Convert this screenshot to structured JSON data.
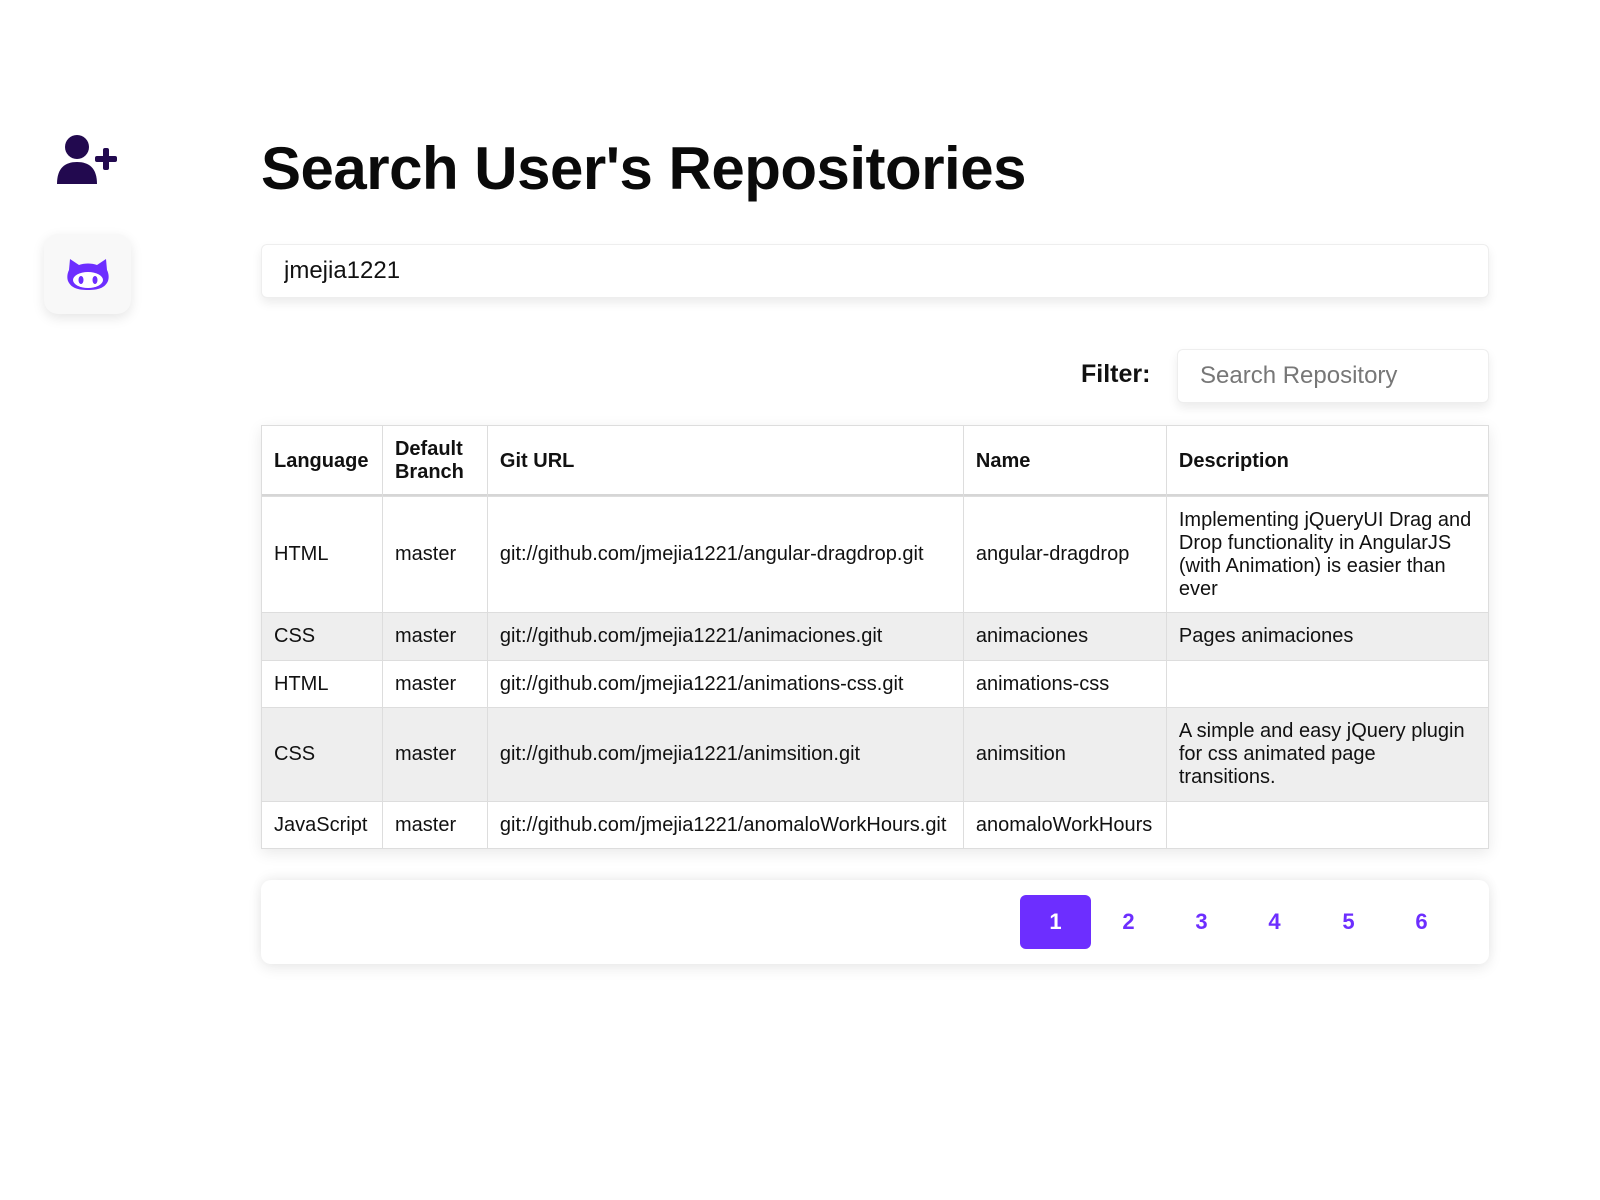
{
  "sidebar": {
    "add_user_icon": "user-plus-icon",
    "github_icon": "github-octocat-icon",
    "colors": {
      "add_user": "#22094f",
      "github": "#6d2eff",
      "github_bg": "#f8f8f8"
    }
  },
  "header": {
    "title": "Search User's Repositories"
  },
  "search": {
    "value": "jmejia1221"
  },
  "filter": {
    "label": "Filter:",
    "placeholder": "Search Repository",
    "value": ""
  },
  "table": {
    "columns": [
      "Language",
      "Default Branch",
      "Git URL",
      "Name",
      "Description"
    ],
    "rows": [
      {
        "language": "HTML",
        "branch": "master",
        "url": "git://github.com/jmejia1221/angular-dragdrop.git",
        "name": "angular-dragdrop",
        "description": "Implementing jQueryUI Drag and Drop functionality in AngularJS (with Animation) is easier than ever"
      },
      {
        "language": "CSS",
        "branch": "master",
        "url": "git://github.com/jmejia1221/animaciones.git",
        "name": "animaciones",
        "description": "Pages animaciones"
      },
      {
        "language": "HTML",
        "branch": "master",
        "url": "git://github.com/jmejia1221/animations-css.git",
        "name": "animations-css",
        "description": ""
      },
      {
        "language": "CSS",
        "branch": "master",
        "url": "git://github.com/jmejia1221/animsition.git",
        "name": "animsition",
        "description": "A simple and easy jQuery plugin for css animated page transitions."
      },
      {
        "language": "JavaScript",
        "branch": "master",
        "url": "git://github.com/jmejia1221/anomaloWorkHours.git",
        "name": "anomaloWorkHours",
        "description": ""
      }
    ]
  },
  "pagination": {
    "pages": [
      "1",
      "2",
      "3",
      "4",
      "5",
      "6"
    ],
    "current": "1",
    "accent": "#6d2eff"
  }
}
